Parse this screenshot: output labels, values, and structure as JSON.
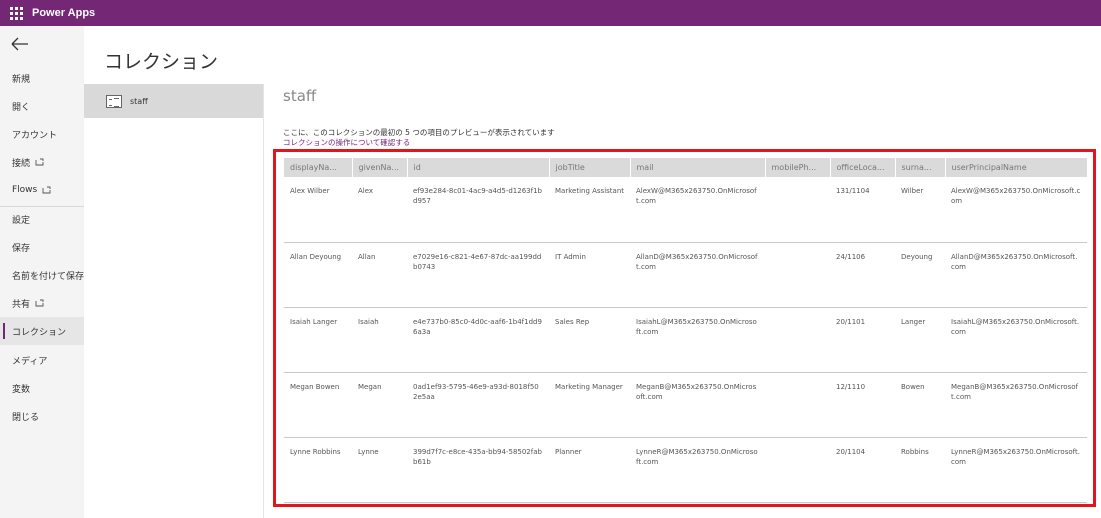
{
  "topbar": {
    "app_title": "Power Apps"
  },
  "nav": {
    "items": [
      {
        "label": "新規"
      },
      {
        "label": "開く"
      },
      {
        "label": "アカウント"
      },
      {
        "label": "接続"
      },
      {
        "label": "Flows"
      },
      {
        "label": "設定"
      },
      {
        "label": "保存"
      },
      {
        "label": "名前を付けて保存"
      },
      {
        "label": "共有"
      },
      {
        "label": "コレクション"
      },
      {
        "label": "メディア"
      },
      {
        "label": "変数"
      },
      {
        "label": "閉じる"
      }
    ]
  },
  "page": {
    "title": "コレクション"
  },
  "collections": [
    {
      "name": "staff"
    }
  ],
  "main": {
    "collection_title": "staff",
    "preview_text": "ここに、このコレクションの最初の 5 つの項目のプレビューが表示されています",
    "preview_link": "コレクションの操作について確認する"
  },
  "table": {
    "headers": [
      "displayNa...",
      "givenNa...",
      "id",
      "jobTitle",
      "mail",
      "mobilePh...",
      "officeLoca...",
      "surna...",
      "userPrincipalName"
    ],
    "rows": [
      [
        "Alex Wilber",
        "Alex",
        "ef93e284-8c01-4ac9-a4d5-d1263f1bd957",
        "Marketing Assistant",
        "AlexW@M365x263750.OnMicrosoft.com",
        "",
        "131/1104",
        "Wilber",
        "AlexW@M365x263750.OnMicrosoft.com"
      ],
      [
        "Allan Deyoung",
        "Allan",
        "e7029e16-c821-4e67-87dc-aa199ddb0743",
        "IT Admin",
        "AllanD@M365x263750.OnMicrosoft.com",
        "",
        "24/1106",
        "Deyoung",
        "AllanD@M365x263750.OnMicrosoft.com"
      ],
      [
        "Isaiah Langer",
        "Isaiah",
        "e4e737b0-85c0-4d0c-aaf6-1b4f1dd96a3a",
        "Sales Rep",
        "IsaiahL@M365x263750.OnMicrosoft.com",
        "",
        "20/1101",
        "Langer",
        "IsaiahL@M365x263750.OnMicrosoft.com"
      ],
      [
        "Megan Bowen",
        "Megan",
        "0ad1ef93-5795-46e9-a93d-8018f502e5aa",
        "Marketing Manager",
        "MeganB@M365x263750.OnMicrosoft.com",
        "",
        "12/1110",
        "Bowen",
        "MeganB@M365x263750.OnMicrosoft.com"
      ],
      [
        "Lynne Robbins",
        "Lynne",
        "399d7f7c-e8ce-435a-bb94-58502fabb61b",
        "Planner",
        "LynneR@M365x263750.OnMicrosoft.com",
        "",
        "20/1104",
        "Robbins",
        "LynneR@M365x263750.OnMicrosoft.com"
      ]
    ]
  },
  "colors": {
    "brand": "#742774",
    "highlight": "#e3151b",
    "nav_bg": "#f4f4f4"
  },
  "icons": {
    "app_launcher": "waffle-icon",
    "back": "back-arrow-icon",
    "external": "external-link-icon",
    "collection": "collection-table-icon"
  }
}
